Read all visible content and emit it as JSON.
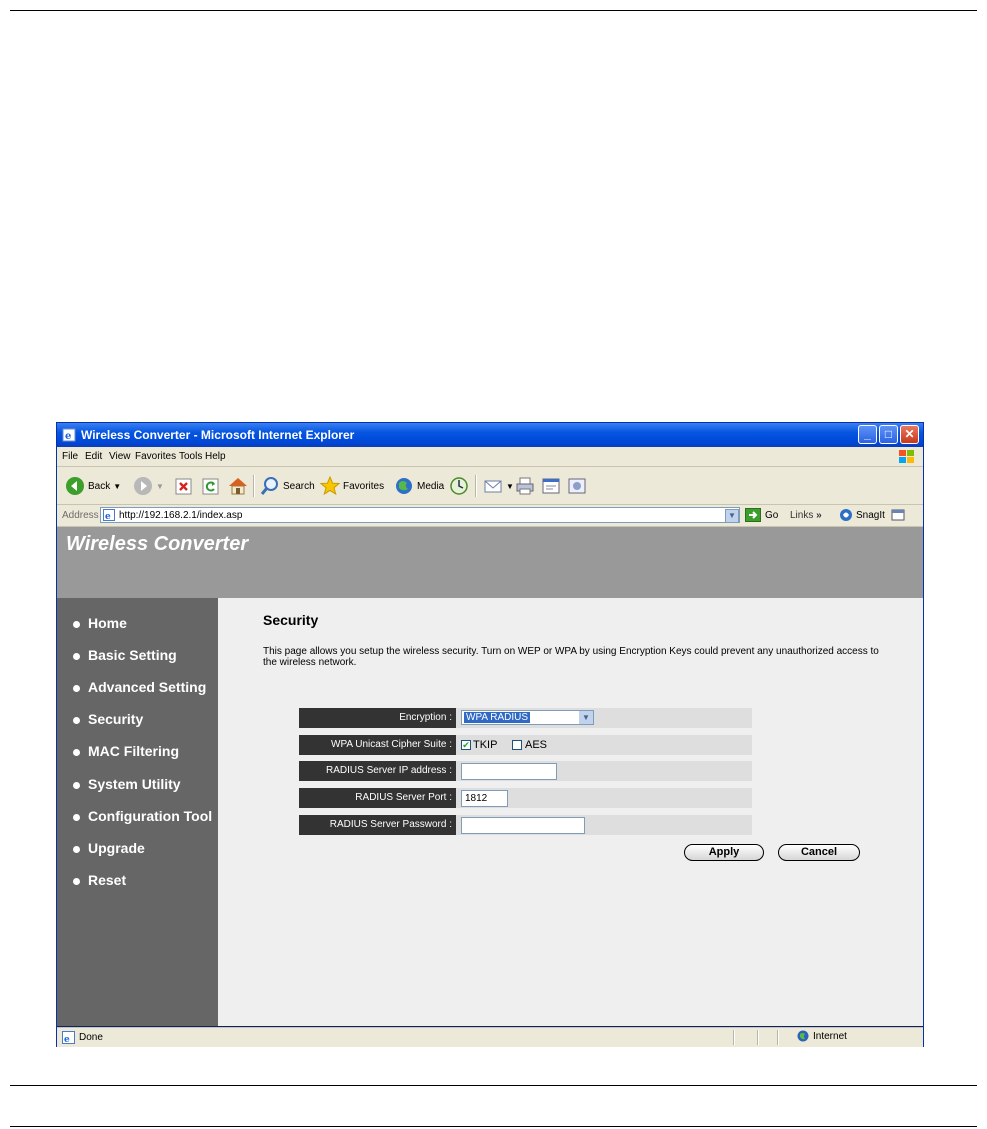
{
  "window": {
    "title": "Wireless Converter - Microsoft Internet Explorer",
    "controls": {
      "minimize": "_",
      "maximize": "□",
      "close": "✕"
    }
  },
  "menu": [
    "File",
    "Edit",
    "View",
    "Favorites",
    "Tools",
    "Help"
  ],
  "toolbar": {
    "back": "Back",
    "search": "Search",
    "favorites": "Favorites",
    "media": "Media"
  },
  "address": {
    "label": "Address",
    "url": "http://192.168.2.1/index.asp",
    "go": "Go",
    "links": "Links",
    "snagit": "SnagIt"
  },
  "app": {
    "title": "Wireless Converter"
  },
  "nav": [
    "Home",
    "Basic Setting",
    "Advanced Setting",
    "Security",
    "MAC Filtering",
    "System Utility",
    "Configuration Tool",
    "Upgrade",
    "Reset"
  ],
  "page": {
    "title": "Security",
    "description": "This page allows you setup the wireless security. Turn on WEP or WPA by using Encryption Keys could prevent any unauthorized access to the wireless network."
  },
  "form": {
    "encryption": {
      "label": "Encryption :",
      "value": "WPA RADIUS"
    },
    "cipher": {
      "label": "WPA Unicast Cipher Suite :",
      "tkip": "TKIP",
      "aes": "AES",
      "tkip_checked": true,
      "aes_checked": false
    },
    "server_ip": {
      "label": "RADIUS Server IP address :",
      "value": ""
    },
    "server_port": {
      "label": "RADIUS Server Port :",
      "value": "1812"
    },
    "server_password": {
      "label": "RADIUS Server Password :",
      "value": ""
    }
  },
  "buttons": {
    "apply": "Apply",
    "cancel": "Cancel"
  },
  "status": {
    "text": "Done",
    "zone": "Internet"
  },
  "colors": {
    "header_bg": "#999999",
    "sidebar_bg": "#666666",
    "content_bg": "#efefef",
    "label_bg": "#333333",
    "row_bg": "#dedede"
  }
}
